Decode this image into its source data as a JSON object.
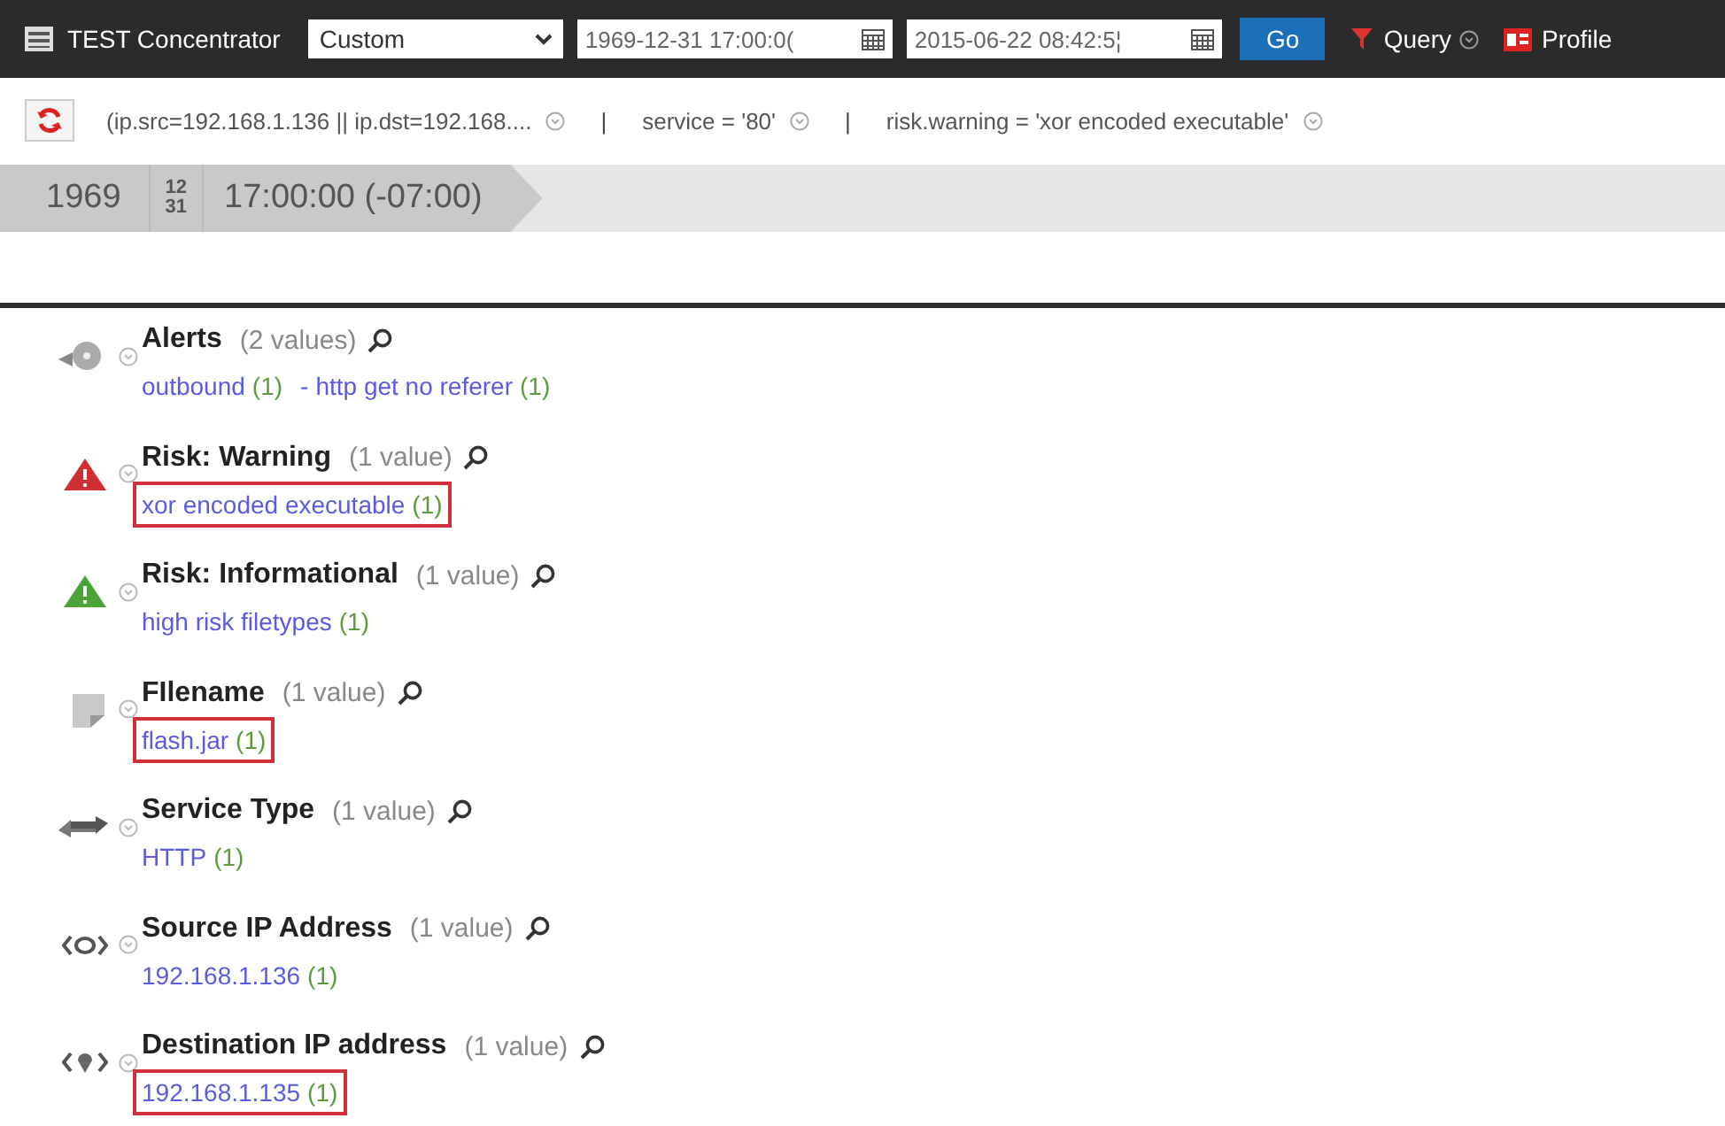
{
  "toolbar": {
    "title": "TEST Concentrator",
    "range_select": "Custom",
    "start_time": "1969-12-31 17:00:0(",
    "end_time": "2015-06-22 08:42:5¦",
    "go": "Go",
    "query": "Query",
    "profile": "Profile"
  },
  "filters": [
    {
      "text": "(ip.src=192.168.1.136 || ip.dst=192.168...."
    },
    {
      "text": "service = '80'"
    },
    {
      "text": "risk.warning = 'xor encoded executable'"
    }
  ],
  "filter_separator": "|",
  "timeline": {
    "year": "1969",
    "month": "12",
    "day": "31",
    "time": "17:00:00 (-07:00)"
  },
  "meta": [
    {
      "kind": "bell",
      "name": "Alerts",
      "count": "(2 values)",
      "values": [
        {
          "text": "outbound",
          "count": "(1)"
        },
        {
          "prefix": "-",
          "text": "http get no referer",
          "count": "(1)"
        }
      ],
      "highlighted": false
    },
    {
      "kind": "warning-red",
      "name": "Risk: Warning",
      "count": "(1 value)",
      "values": [
        {
          "text": "xor encoded executable",
          "count": "(1)"
        }
      ],
      "highlighted": true
    },
    {
      "kind": "warning-green",
      "name": "Risk: Informational",
      "count": "(1 value)",
      "values": [
        {
          "text": "high risk filetypes",
          "count": "(1)"
        }
      ],
      "highlighted": false
    },
    {
      "kind": "file",
      "name": "FIlename",
      "count": "(1 value)",
      "values": [
        {
          "text": "flash.jar",
          "count": "(1)"
        }
      ],
      "highlighted": true
    },
    {
      "kind": "arrows",
      "name": "Service Type",
      "count": "(1 value)",
      "values": [
        {
          "text": "HTTP",
          "count": "(1)"
        }
      ],
      "highlighted": false
    },
    {
      "kind": "source",
      "name": "Source IP Address",
      "count": "(1 value)",
      "values": [
        {
          "text": "192.168.1.136",
          "count": "(1)"
        }
      ],
      "highlighted": false
    },
    {
      "kind": "dest",
      "name": "Destination IP address",
      "count": "(1 value)",
      "values": [
        {
          "text": "192.168.1.135",
          "count": "(1)"
        }
      ],
      "highlighted": true
    }
  ]
}
